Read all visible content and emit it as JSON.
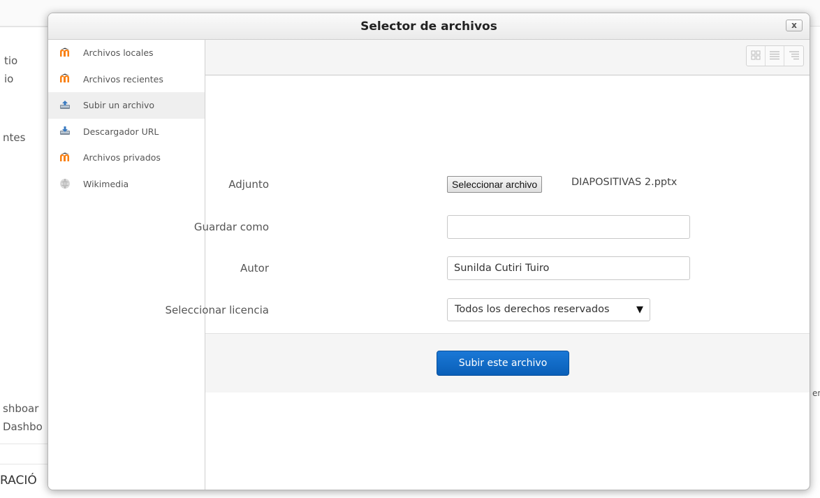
{
  "background": {
    "fragments": [
      "tio",
      "io",
      "ntes",
      "shboar",
      "Dashbo",
      "RACIÓ",
      "en"
    ]
  },
  "dialog": {
    "title": "Selector de archivos",
    "close_label": "x"
  },
  "sidebar": {
    "items": [
      {
        "label": "Archivos locales",
        "icon": "moodle-icon"
      },
      {
        "label": "Archivos recientes",
        "icon": "moodle-icon"
      },
      {
        "label": "Subir un archivo",
        "icon": "upload-icon",
        "active": true
      },
      {
        "label": "Descargador URL",
        "icon": "download-icon"
      },
      {
        "label": "Archivos privados",
        "icon": "moodle-icon"
      },
      {
        "label": "Wikimedia",
        "icon": "wikimedia-icon"
      }
    ]
  },
  "toolbar": {
    "views": [
      "icons-view",
      "list-view",
      "tree-view"
    ]
  },
  "form": {
    "attachment_label": "Adjunto",
    "choose_file_button": "Seleccionar archivo",
    "chosen_file": "DIAPOSITIVAS 2.pptx",
    "save_as_label": "Guardar como",
    "save_as_value": "",
    "author_label": "Autor",
    "author_value": "Sunilda Cutiri Tuiro",
    "license_label": "Seleccionar licencia",
    "license_value": "Todos los derechos reservados",
    "submit_button": "Subir este archivo"
  },
  "colors": {
    "primary_button": "#0f6cc7",
    "moodle_orange": "#f98012"
  }
}
